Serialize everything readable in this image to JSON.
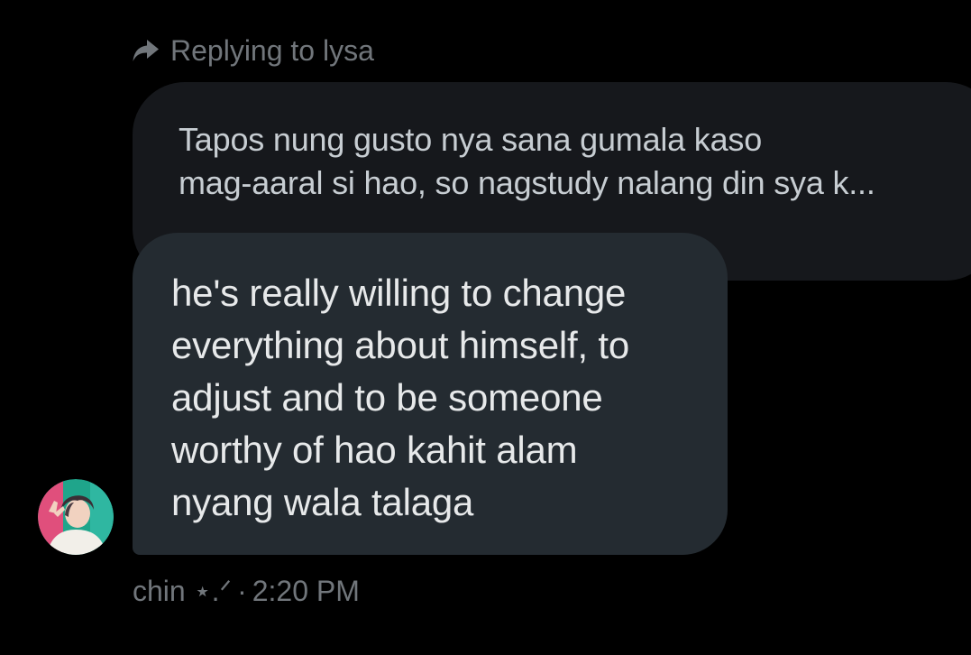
{
  "reply": {
    "label": "Replying to lysa",
    "icon": "reply-arrow-icon"
  },
  "quoted_message": {
    "lines": [
      "Tapos nung gusto nya sana gumala kaso",
      "mag-aaral si hao, so nagstudy nalang din sya k..."
    ]
  },
  "message": {
    "lines": [
      "he's really willing to change",
      "everything about himself, to",
      "adjust and to be someone",
      "worthy of hao kahit alam",
      "nyang wala talaga"
    ]
  },
  "sender": {
    "name": "chin ⋆.ᐟ",
    "separator": "·",
    "time": "2:20 PM",
    "avatar": "avatar-photo"
  },
  "colors": {
    "background": "#000000",
    "quoted_bubble": "#16181c",
    "message_bubble": "#242b31",
    "secondary_text": "#71767b",
    "primary_text": "#e7e9ea"
  }
}
